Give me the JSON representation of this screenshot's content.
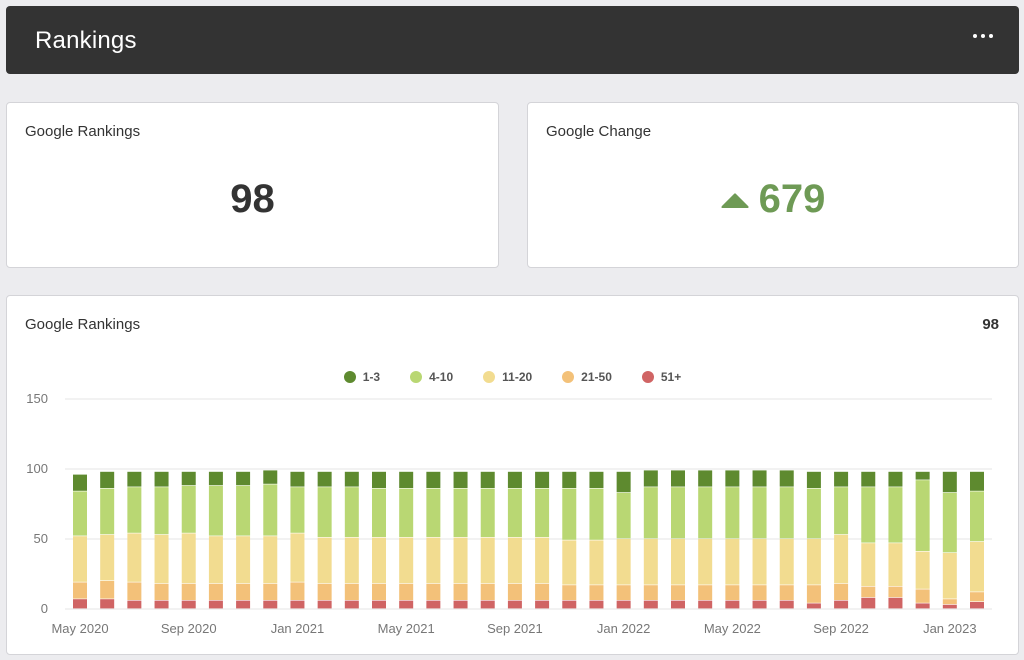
{
  "header": {
    "title": "Rankings",
    "menu_icon": "more-horizontal-icon"
  },
  "card_rankings": {
    "title": "Google Rankings",
    "value": "98"
  },
  "card_change": {
    "title": "Google Change",
    "value": "679",
    "trend_icon": "triangle-up-icon",
    "color": "#6e9a55"
  },
  "chart_card": {
    "title": "Google Rankings",
    "total": "98"
  },
  "colors": {
    "c1_3": "#5e8a2f",
    "c4_10": "#b9d773",
    "c11_20": "#f2dc90",
    "c21_50": "#f3c179",
    "c51": "#d06464"
  },
  "chart_data": {
    "type": "bar",
    "stacked": true,
    "ylim": [
      0,
      150
    ],
    "yticks": [
      "0",
      "50",
      "100",
      "150"
    ],
    "grid": true,
    "legend_position": "top-center",
    "x_tick_labels": [
      {
        "label": "May 2020",
        "index": 0
      },
      {
        "label": "Sep 2020",
        "index": 4
      },
      {
        "label": "Jan 2021",
        "index": 8
      },
      {
        "label": "May 2021",
        "index": 12
      },
      {
        "label": "Sep 2021",
        "index": 16
      },
      {
        "label": "Jan 2022",
        "index": 20
      },
      {
        "label": "May 2022",
        "index": 24
      },
      {
        "label": "Sep 2022",
        "index": 28
      },
      {
        "label": "Jan 2023",
        "index": 32
      }
    ],
    "categories": [
      "May 2020",
      "Jun 2020",
      "Jul 2020",
      "Aug 2020",
      "Sep 2020",
      "Oct 2020",
      "Nov 2020",
      "Dec 2020",
      "Jan 2021",
      "Feb 2021",
      "Mar 2021",
      "Apr 2021",
      "May 2021",
      "Jun 2021",
      "Jul 2021",
      "Aug 2021",
      "Sep 2021",
      "Oct 2021",
      "Nov 2021",
      "Dec 2021",
      "Jan 2022",
      "Feb 2022",
      "Mar 2022",
      "Apr 2022",
      "May 2022",
      "Jun 2022",
      "Jul 2022",
      "Aug 2022",
      "Sep 2022",
      "Oct 2022",
      "Nov 2022",
      "Dec 2022",
      "Jan 2023",
      "Feb 2023"
    ],
    "series": [
      {
        "name": "51+",
        "color_key": "c51",
        "values": [
          7,
          7,
          6,
          6,
          6,
          6,
          6,
          6,
          6,
          6,
          6,
          6,
          6,
          6,
          6,
          6,
          6,
          6,
          6,
          6,
          6,
          6,
          6,
          6,
          6,
          6,
          6,
          4,
          6,
          8,
          8,
          4,
          3,
          5
        ]
      },
      {
        "name": "21-50",
        "color_key": "c21_50",
        "values": [
          12,
          13,
          13,
          12,
          12,
          12,
          12,
          12,
          13,
          12,
          12,
          12,
          12,
          12,
          12,
          12,
          12,
          12,
          11,
          11,
          11,
          11,
          11,
          11,
          11,
          11,
          11,
          13,
          12,
          8,
          8,
          10,
          4,
          7
        ]
      },
      {
        "name": "11-20",
        "color_key": "c11_20",
        "values": [
          33,
          33,
          35,
          35,
          36,
          34,
          34,
          34,
          35,
          33,
          33,
          33,
          33,
          33,
          33,
          33,
          33,
          33,
          32,
          32,
          33,
          33,
          33,
          33,
          33,
          33,
          33,
          33,
          35,
          31,
          31,
          27,
          33,
          36
        ]
      },
      {
        "name": "4-10",
        "color_key": "c4_10",
        "values": [
          32,
          33,
          33,
          34,
          34,
          36,
          36,
          37,
          33,
          36,
          36,
          35,
          35,
          35,
          35,
          35,
          35,
          35,
          37,
          37,
          33,
          37,
          37,
          37,
          37,
          37,
          37,
          36,
          34,
          40,
          40,
          51,
          43,
          36
        ]
      },
      {
        "name": "1-3",
        "color_key": "c1_3",
        "values": [
          12,
          12,
          11,
          11,
          10,
          10,
          10,
          10,
          11,
          11,
          11,
          12,
          12,
          12,
          12,
          12,
          12,
          12,
          12,
          12,
          15,
          12,
          12,
          12,
          12,
          12,
          12,
          12,
          11,
          11,
          11,
          6,
          15,
          14
        ]
      }
    ],
    "legend": [
      "1-3",
      "4-10",
      "11-20",
      "21-50",
      "51+"
    ]
  }
}
